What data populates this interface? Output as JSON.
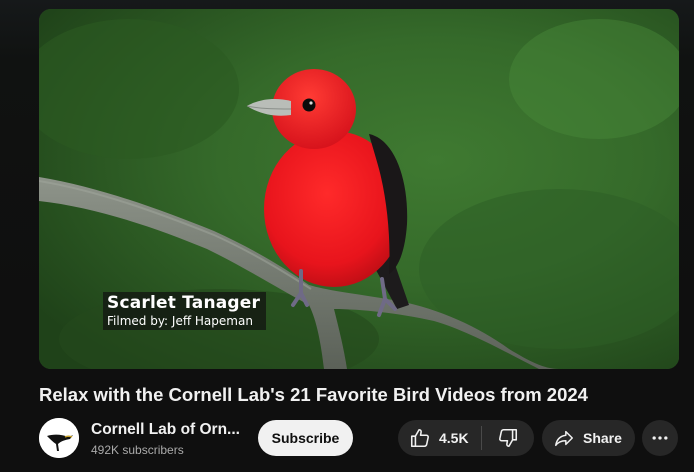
{
  "video": {
    "overlay_title": "Scarlet Tanager",
    "overlay_credit": "Filmed by: Jeff Hapeman",
    "title": "Relax with the Cornell Lab's 21 Favorite Bird Videos from 2024"
  },
  "channel": {
    "name": "Cornell Lab of Orn...",
    "subscribers": "492K subscribers",
    "subscribe_label": "Subscribe"
  },
  "actions": {
    "like_count": "4.5K",
    "share_label": "Share",
    "like_icon": "thumbs-up-icon",
    "dislike_icon": "thumbs-down-icon",
    "share_icon": "share-arrow-icon",
    "more_icon": "more-horizontal-icon"
  },
  "colors": {
    "background": "#0f0f0f",
    "text_primary": "#f1f1f1",
    "text_secondary": "#aaaaaa",
    "pill_background": "#272727",
    "subscribe_background": "#f1f1f1",
    "bird_red": "#e8141c"
  }
}
